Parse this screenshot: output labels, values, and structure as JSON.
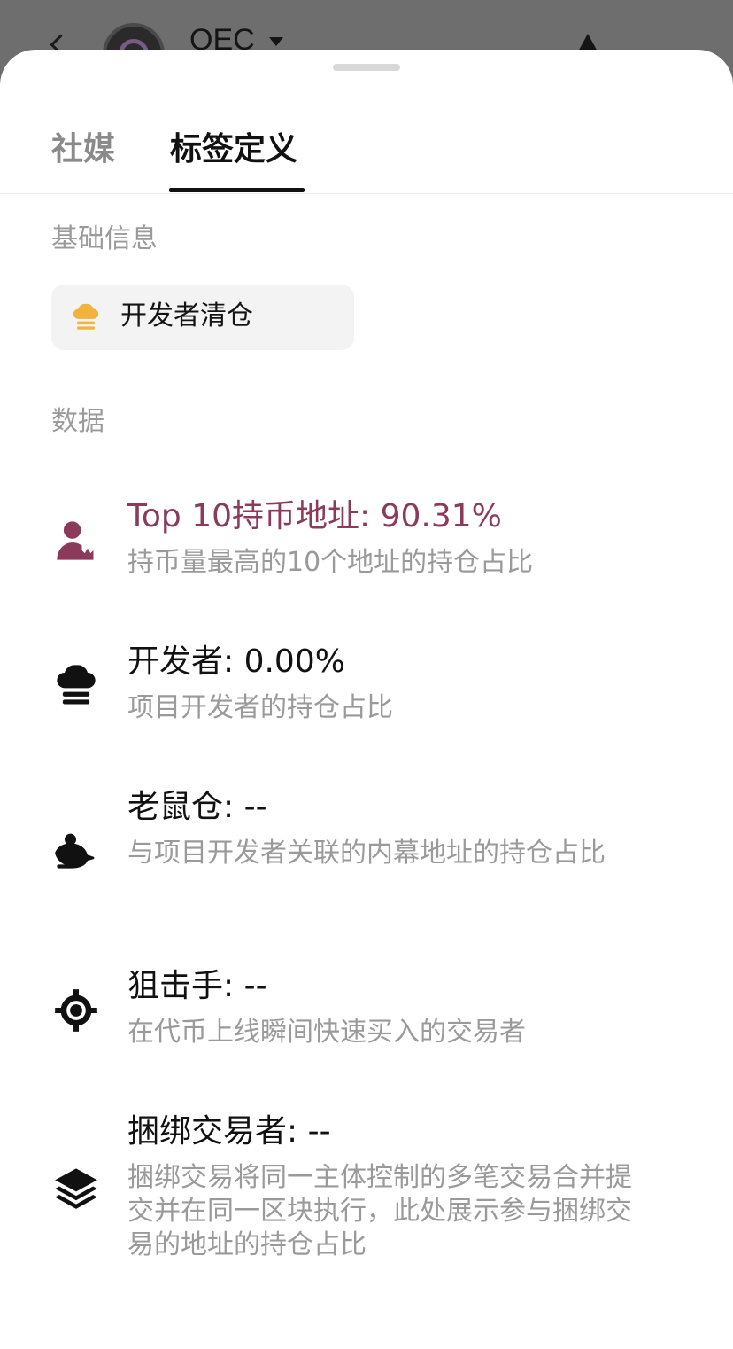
{
  "background": {
    "token_name": "QEC"
  },
  "sheet": {
    "tabs": [
      {
        "label": "社媒",
        "active": false
      },
      {
        "label": "标签定义",
        "active": true
      }
    ],
    "basic_section": {
      "title": "基础信息",
      "chip": {
        "label": "开发者清仓",
        "icon": "chef-hat-icon",
        "icon_color": "#f2b33d"
      }
    },
    "data_section": {
      "title": "数据",
      "items": [
        {
          "title": "Top 10持币地址: 90.31%",
          "desc": "持币量最高的10个地址的持仓占比",
          "icon": "top-holder-icon",
          "highlight": true,
          "color": "#8c3a5c"
        },
        {
          "title": "开发者: 0.00%",
          "desc": "项目开发者的持仓占比",
          "icon": "chef-hat-icon"
        },
        {
          "title": "老鼠仓: --",
          "desc": "与项目开发者关联的内幕地址的持仓占比",
          "icon": "rat-icon"
        },
        {
          "title": "狙击手: --",
          "desc": "在代币上线瞬间快速买入的交易者",
          "icon": "crosshair-icon"
        },
        {
          "title": "捆绑交易者: --",
          "desc": "捆绑交易将同一主体控制的多笔交易合并提交并在同一区块执行，此处展示参与捆绑交易的地址的持仓占比",
          "icon": "layers-icon"
        }
      ]
    }
  }
}
